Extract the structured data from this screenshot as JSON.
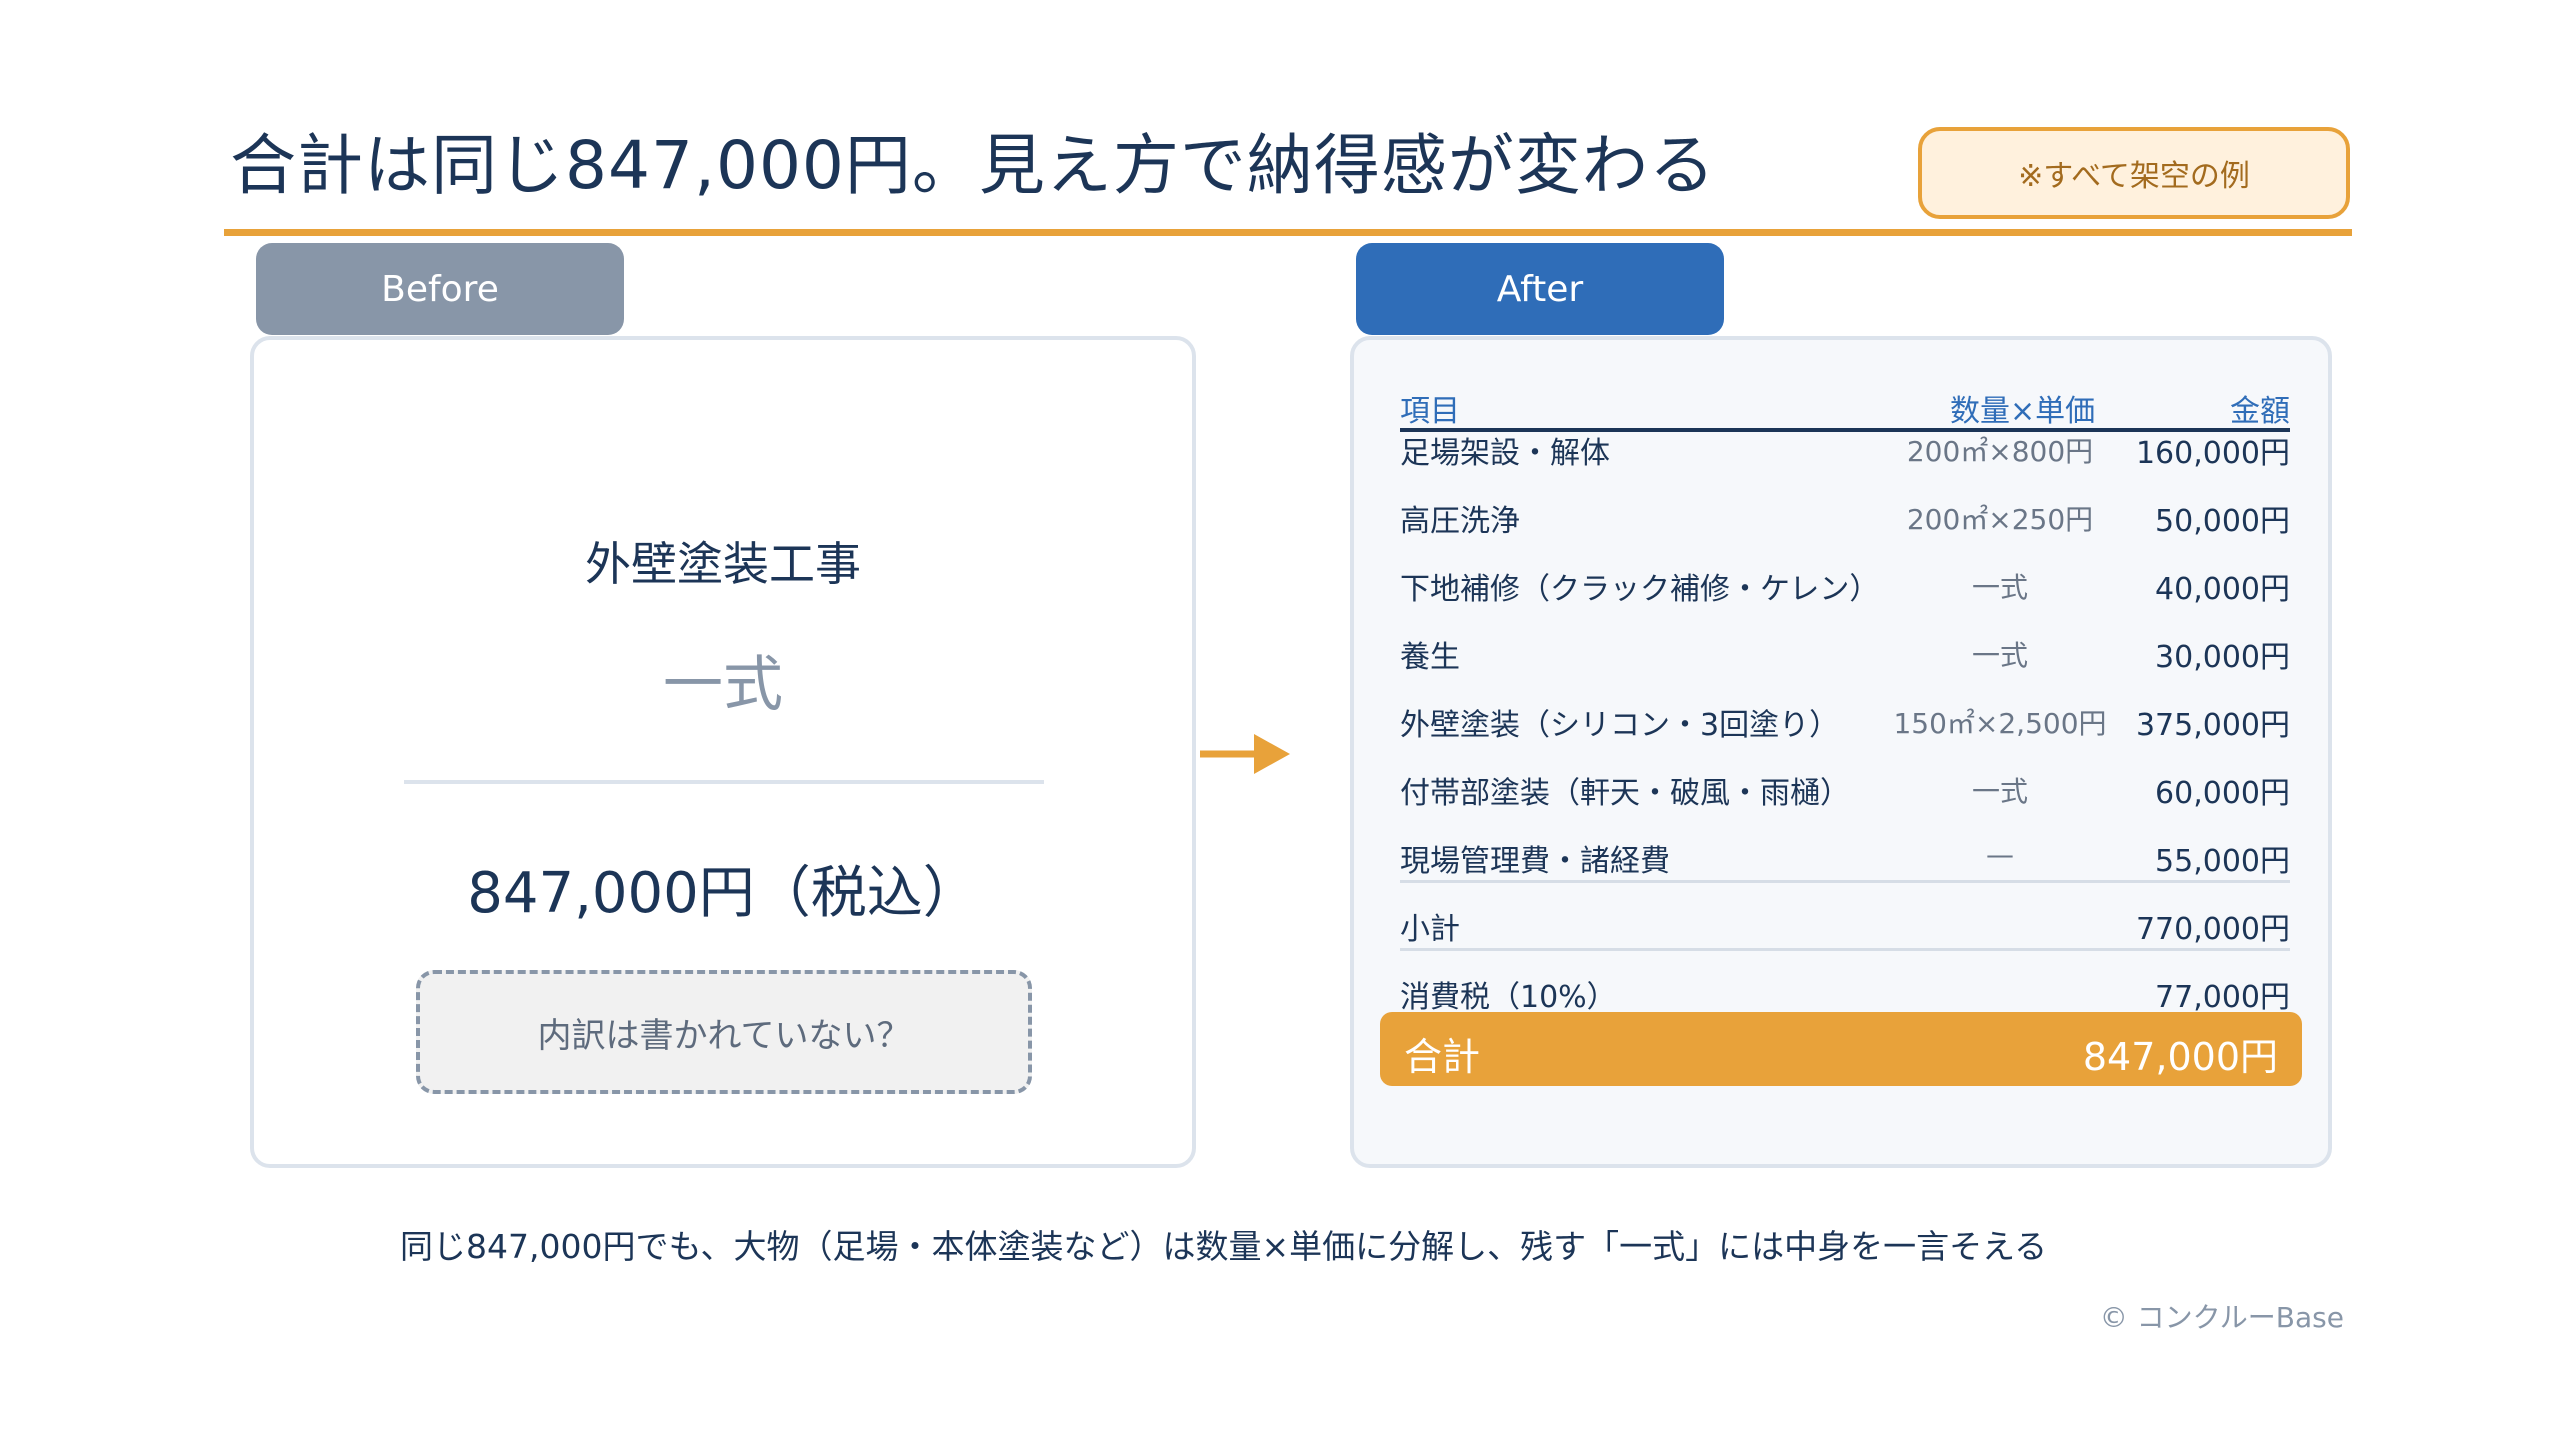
{
  "header": {
    "title": "合計は同じ847,000円。見え方で納得感が変わる",
    "note_badge": "※すべて架空の例"
  },
  "colors": {
    "accent_orange": "#e8a23a",
    "navy": "#1c3557",
    "before_gray": "#8896a8",
    "after_blue": "#2f6db8"
  },
  "before": {
    "tab_label": "Before",
    "work_name": "外壁塗装工事",
    "lump_sum": "一式",
    "total": "847,000円（税込）",
    "question": "内訳は書かれていない？"
  },
  "arrow_icon": "right-arrow-icon",
  "after": {
    "tab_label": "After",
    "columns": {
      "item": "項目",
      "qty_price": "数量×単価",
      "amount": "金額"
    },
    "rows": [
      {
        "name": "足場架設・解体",
        "qty": "200㎡×800円",
        "amount": "160,000円"
      },
      {
        "name": "高圧洗浄",
        "qty": "200㎡×250円",
        "amount": "50,000円"
      },
      {
        "name": "下地補修（クラック補修・ケレン）",
        "qty": "一式",
        "amount": "40,000円"
      },
      {
        "name": "養生",
        "qty": "一式",
        "amount": "30,000円"
      },
      {
        "name": "外壁塗装（シリコン・3回塗り）",
        "qty": "150㎡×2,500円",
        "amount": "375,000円"
      },
      {
        "name": "付帯部塗装（軒天・破風・雨樋）",
        "qty": "一式",
        "amount": "60,000円"
      },
      {
        "name": "現場管理費・諸経費",
        "qty": "—",
        "amount": "55,000円"
      }
    ],
    "subtotal": {
      "label": "小計",
      "amount": "770,000円"
    },
    "tax": {
      "label": "消費税（10%）",
      "amount": "77,000円"
    },
    "total": {
      "label": "合計",
      "amount": "847,000円"
    }
  },
  "footer": {
    "summary": "同じ847,000円でも、大物（足場・本体塗装など）は数量×単価に分解し、残す「一式」には中身を一言そえる",
    "copyright": "© コンクルーBase"
  }
}
